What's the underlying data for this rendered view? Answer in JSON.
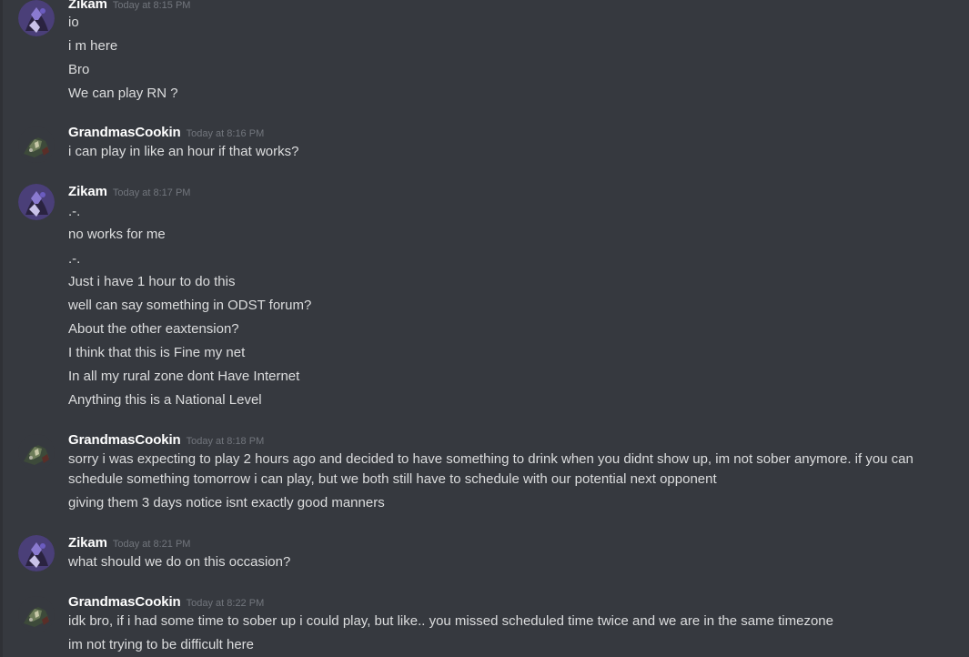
{
  "colors": {
    "background": "#36393f",
    "username": "#ffffff",
    "message_text": "#dcddde",
    "timestamp": "#72767d"
  },
  "messages": [
    {
      "author": "Zikam",
      "avatar": "zikam-avatar-icon",
      "timestamp": "Today at 8:15 PM",
      "lines": [
        "io",
        "i m here",
        "Bro",
        "We can play RN ?"
      ]
    },
    {
      "author": "GrandmasCookin",
      "avatar": "grandmascookin-avatar-icon",
      "timestamp": "Today at 8:16 PM",
      "lines": [
        "i can play in like an hour if that works?"
      ]
    },
    {
      "author": "Zikam",
      "avatar": "zikam-avatar-icon",
      "timestamp": "Today at 8:17 PM",
      "lines": [
        ".-.",
        "no works for me",
        ".-.",
        "Just i have 1 hour to do this",
        "well can say something in ODST forum?",
        "About  the other eaxtension?",
        "I think that this is Fine my net",
        "In all my rural zone dont Have Internet",
        "Anything this is a National Level"
      ]
    },
    {
      "author": "GrandmasCookin",
      "avatar": "grandmascookin-avatar-icon",
      "timestamp": "Today at 8:18 PM",
      "lines": [
        "sorry i was expecting to play 2 hours ago and decided to have something to drink when you didnt show up, im not sober anymore. if you can schedule something tomorrow i can play, but we both still have to schedule with our potential next opponent",
        "giving them 3 days notice isnt exactly good manners"
      ]
    },
    {
      "author": "Zikam",
      "avatar": "zikam-avatar-icon",
      "timestamp": "Today at 8:21 PM",
      "lines": [
        "what should we do on this occasion?"
      ]
    },
    {
      "author": "GrandmasCookin",
      "avatar": "grandmascookin-avatar-icon",
      "timestamp": "Today at 8:22 PM",
      "lines": [
        "idk bro, if i had some time to sober up i could play, but like.. you missed scheduled time twice and we are in the same timezone",
        "im not trying to be difficult here"
      ]
    }
  ]
}
